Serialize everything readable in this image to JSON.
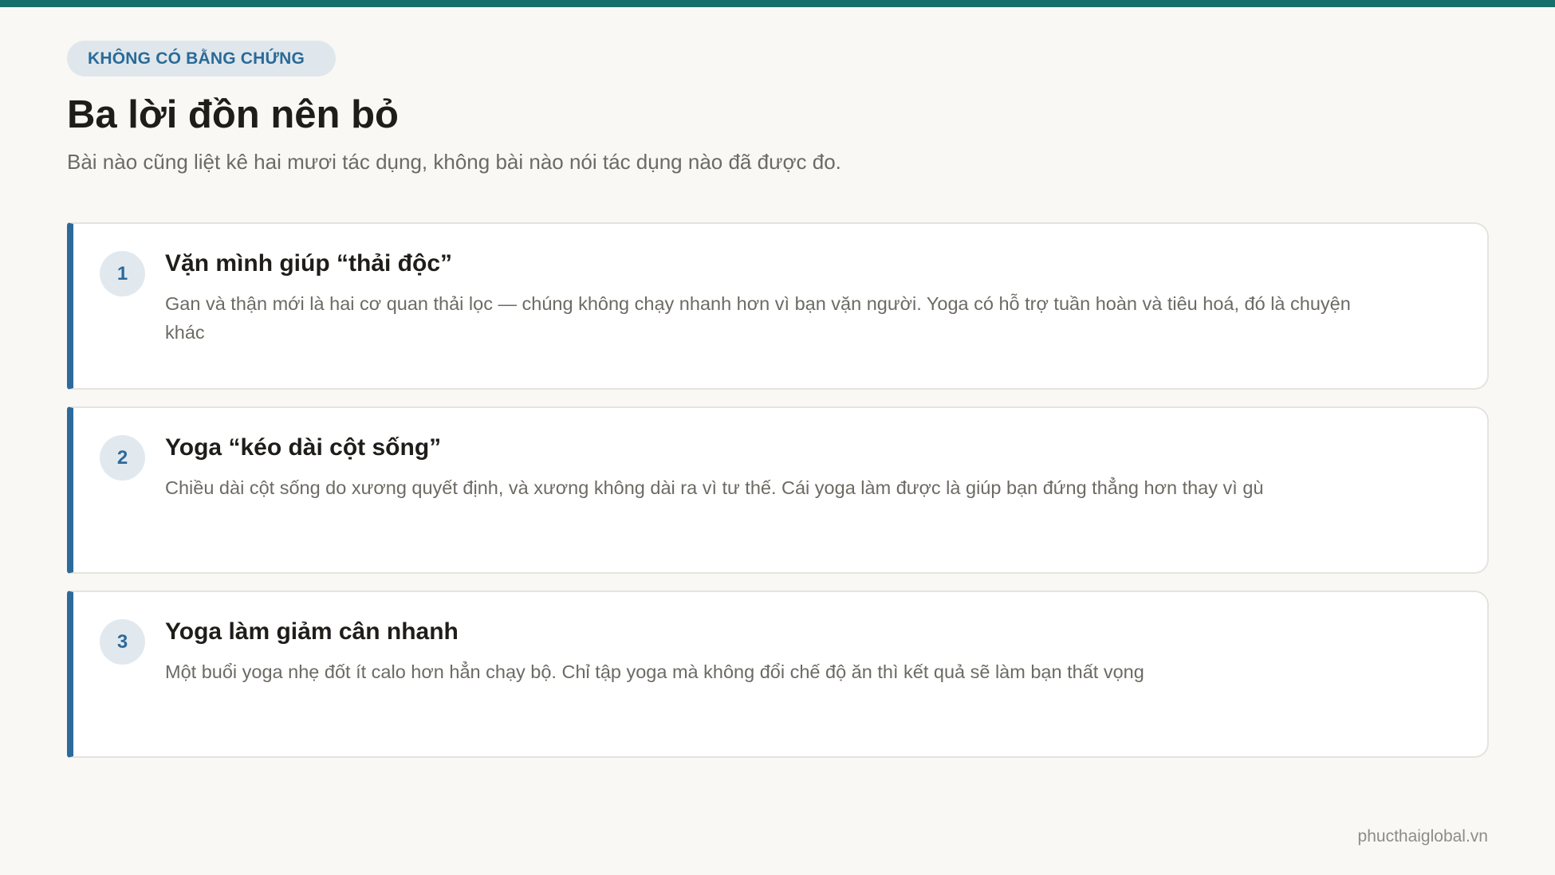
{
  "badge": "KHÔNG CÓ BẰNG CHỨNG",
  "title": "Ba lời đồn nên bỏ",
  "subtitle": "Bài nào cũng liệt kê hai mươi tác dụng, không bài nào nói tác dụng nào đã được đo.",
  "cards": [
    {
      "number": "1",
      "title": "Vặn mình giúp “thải độc”",
      "body": "Gan và thận mới là hai cơ quan thải lọc — chúng không chạy nhanh hơn vì bạn vặn người. Yoga có hỗ trợ tuần hoàn và tiêu hoá, đó là chuyện khác"
    },
    {
      "number": "2",
      "title": "Yoga “kéo dài cột sống”",
      "body": "Chiều dài cột sống do xương quyết định, và xương không dài ra vì tư thế. Cái yoga làm được là giúp bạn đứng thẳng hơn thay vì gù"
    },
    {
      "number": "3",
      "title": "Yoga làm giảm cân nhanh",
      "body": "Một buổi yoga nhẹ đốt ít calo hơn hẳn chạy bộ. Chỉ tập yoga mà không đổi chế độ ăn thì kết quả sẽ làm bạn thất vọng"
    }
  ],
  "footer": "phucthaiglobal.vn",
  "colors": {
    "accent": "#15706b",
    "card_border_accent": "#2d6a9c",
    "badge_bg": "#dfe7ec",
    "badge_text": "#2a6a98",
    "background": "#f9f8f5"
  }
}
